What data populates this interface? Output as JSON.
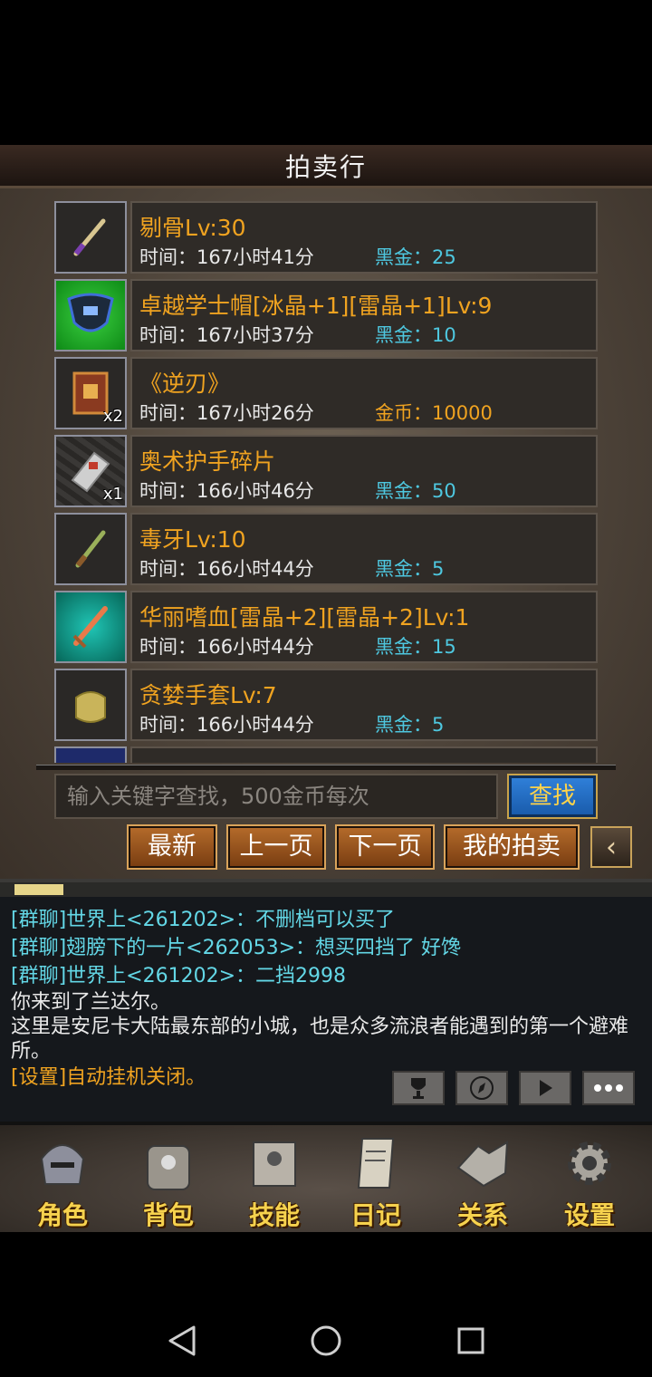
{
  "title": "拍卖行",
  "items": [
    {
      "name": "剔骨Lv:30",
      "time": "时间：167小时41分",
      "price_label": "黑金：",
      "price_value": "25",
      "currency": "black",
      "icon": "dagger-icon",
      "count": ""
    },
    {
      "name": "卓越学士帽[冰晶+1][雷晶+1]Lv:9",
      "time": "时间：167小时37分",
      "price_label": "黑金：",
      "price_value": "10",
      "currency": "black",
      "icon": "helmet-icon",
      "count": ""
    },
    {
      "name": "《逆刃》",
      "time": "时间：167小时26分",
      "price_label": "金币：",
      "price_value": "10000",
      "currency": "gold",
      "icon": "book-icon",
      "count": "x2"
    },
    {
      "name": "奥术护手碎片",
      "time": "时间：166小时46分",
      "price_label": "黑金：",
      "price_value": "50",
      "currency": "black",
      "icon": "gauntlet-shard-icon",
      "count": "x1"
    },
    {
      "name": "毒牙Lv:10",
      "time": "时间：166小时44分",
      "price_label": "黑金：",
      "price_value": "5",
      "currency": "black",
      "icon": "dagger-icon",
      "count": ""
    },
    {
      "name": "华丽嗜血[雷晶+2][雷晶+2]Lv:1",
      "time": "时间：166小时44分",
      "price_label": "黑金：",
      "price_value": "15",
      "currency": "black",
      "icon": "sword-icon",
      "count": ""
    },
    {
      "name": "贪婪手套Lv:7",
      "time": "时间：166小时44分",
      "price_label": "黑金：",
      "price_value": "5",
      "currency": "black",
      "icon": "glove-icon",
      "count": ""
    }
  ],
  "search": {
    "placeholder": "输入关键字查找，500金币每次",
    "button": "查找"
  },
  "nav": {
    "latest": "最新",
    "prev": "上一页",
    "next": "下一页",
    "mine": "我的拍卖"
  },
  "chat": {
    "lines": [
      {
        "type": "group",
        "text": "[群聊]世界上<261202>：不删档可以买了"
      },
      {
        "type": "group",
        "text": "[群聊]翅膀下的一片<262053>：想买四挡了  好馋"
      },
      {
        "type": "group",
        "text": "[群聊]世界上<261202>：二挡2998"
      },
      {
        "type": "sys",
        "text": "你来到了兰达尔。"
      },
      {
        "type": "sys",
        "text": "这里是安尼卡大陆最东部的小城，也是众多流浪者能遇到的第一个避难所。"
      },
      {
        "type": "setting",
        "text": "[设置]自动挂机关闭。"
      }
    ]
  },
  "tabs": [
    {
      "label": "角色",
      "icon": "helmet-icon"
    },
    {
      "label": "背包",
      "icon": "backpack-icon"
    },
    {
      "label": "技能",
      "icon": "skill-book-icon"
    },
    {
      "label": "日记",
      "icon": "scroll-icon"
    },
    {
      "label": "关系",
      "icon": "handshake-icon"
    },
    {
      "label": "设置",
      "icon": "gear-icon"
    }
  ]
}
